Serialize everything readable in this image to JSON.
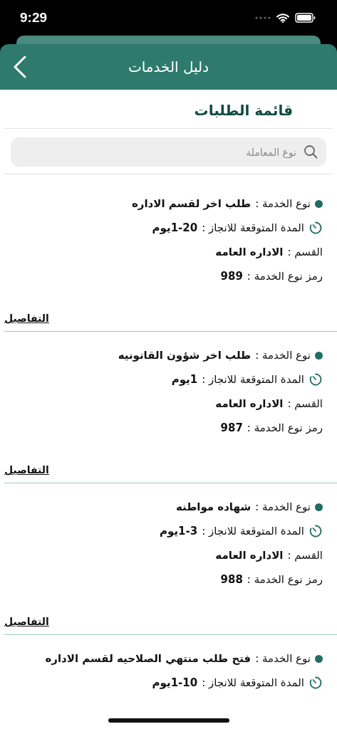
{
  "status_bar": {
    "time": "9:29"
  },
  "header": {
    "title": "دليل الخدمات"
  },
  "section_title": "قائمة الطلبات",
  "search": {
    "placeholder": "نوع المعاملة"
  },
  "requests": [
    {
      "service_label": "نوع الخدمة :",
      "service": "طلب اخر لقسم الاداره",
      "duration_label": "المدة المتوقعة للانجاز :",
      "duration": "1-20يوم",
      "department_label": "القسم :",
      "department": "الاداره العامه",
      "code_label": "رمز نوع الخدمة :",
      "code": "989",
      "details": "التفاصيل"
    },
    {
      "service_label": "نوع الخدمة :",
      "service": "طلب اخر شؤون القانونيه",
      "duration_label": "المدة المتوقعة للانجاز :",
      "duration": "1يوم",
      "department_label": "القسم :",
      "department": "الاداره العامه",
      "code_label": "رمز نوع الخدمة :",
      "code": "987",
      "details": "التفاصيل"
    },
    {
      "service_label": "نوع الخدمة :",
      "service": "شهاده مواطنه",
      "duration_label": "المدة المتوقعة للانجاز :",
      "duration": "1-3يوم",
      "department_label": "القسم :",
      "department": "الاداره العامه",
      "code_label": "رمز نوع الخدمة :",
      "code": "988",
      "details": "التفاصيل"
    },
    {
      "service_label": "نوع الخدمة :",
      "service": "فتح طلب منتهي الصلاحيه لقسم الاداره",
      "duration_label": "المدة المتوقعة للانجاز :",
      "duration": "1-10يوم"
    }
  ]
}
